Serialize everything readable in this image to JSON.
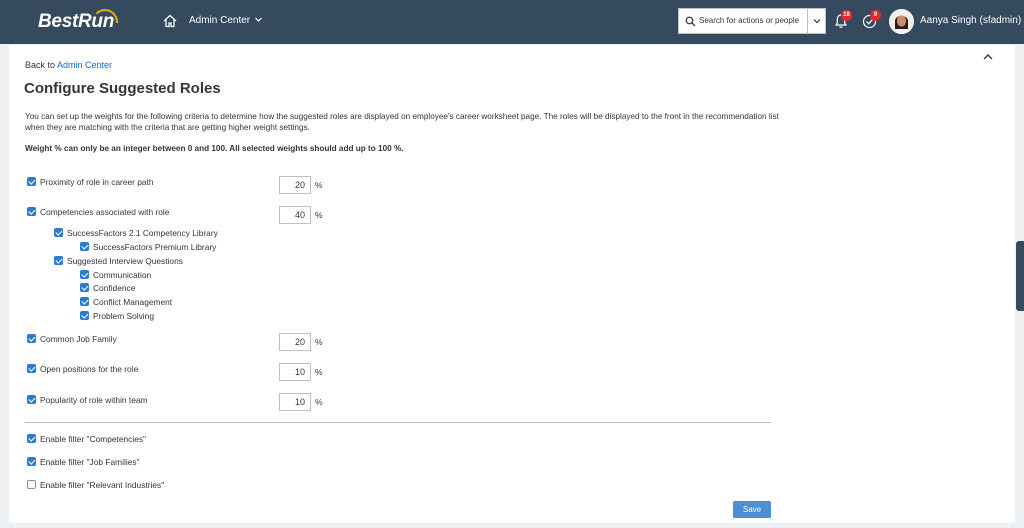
{
  "header": {
    "logo": "BestRun",
    "nav_label": "Admin Center",
    "search_placeholder": "Search for actions or people",
    "notification_count": "18",
    "todo_count": "9",
    "user_name": "Aanya Singh (sfadmin)"
  },
  "page": {
    "back_prefix": "Back to",
    "back_link": "Admin Center",
    "title": "Configure Suggested Roles",
    "description": "You can set up the weights for the following criteria to determine how the suggested roles are displayed on employee's career worksheet page. The roles will be displayed to the front in the recommendation list when they are matching with the criteria that are getting higher weight settings.",
    "note": "Weight % can only be an integer between 0 and 100. All selected weights should add up to 100 %.",
    "percent_symbol": "%"
  },
  "criteria": {
    "proximity": {
      "label": "Proximity of role in career path",
      "checked": true,
      "weight": "20"
    },
    "competencies": {
      "label": "Competencies associated with role",
      "checked": true,
      "weight": "40"
    },
    "sf21_library": {
      "label": "SuccessFactors 2.1 Competency Library",
      "checked": true
    },
    "sf_premium_library": {
      "label": "SuccessFactors Premium Library",
      "checked": true
    },
    "interview_questions": {
      "label": "Suggested Interview Questions",
      "checked": true
    },
    "communication": {
      "label": "Communication",
      "checked": true
    },
    "confidence": {
      "label": "Confidence",
      "checked": true
    },
    "conflict_management": {
      "label": "Conflict Management",
      "checked": true
    },
    "problem_solving": {
      "label": "Problem Solving",
      "checked": true
    },
    "job_family": {
      "label": "Common Job Family",
      "checked": true,
      "weight": "20"
    },
    "open_positions": {
      "label": "Open positions for the role",
      "checked": true,
      "weight": "10"
    },
    "popularity": {
      "label": "Popularity of role within team",
      "checked": true,
      "weight": "10"
    }
  },
  "filters": {
    "competencies": {
      "label": "Enable filter \"Competencies\"",
      "checked": true
    },
    "job_families": {
      "label": "Enable filter \"Job Families\"",
      "checked": true
    },
    "relevant_industries": {
      "label": "Enable filter \"Relevant Industries\"",
      "checked": false
    }
  },
  "actions": {
    "save": "Save"
  },
  "colors": {
    "shell": "#354a5f",
    "accent": "#2d7bd1",
    "badge": "#e52929",
    "link": "#0a6ed1"
  }
}
